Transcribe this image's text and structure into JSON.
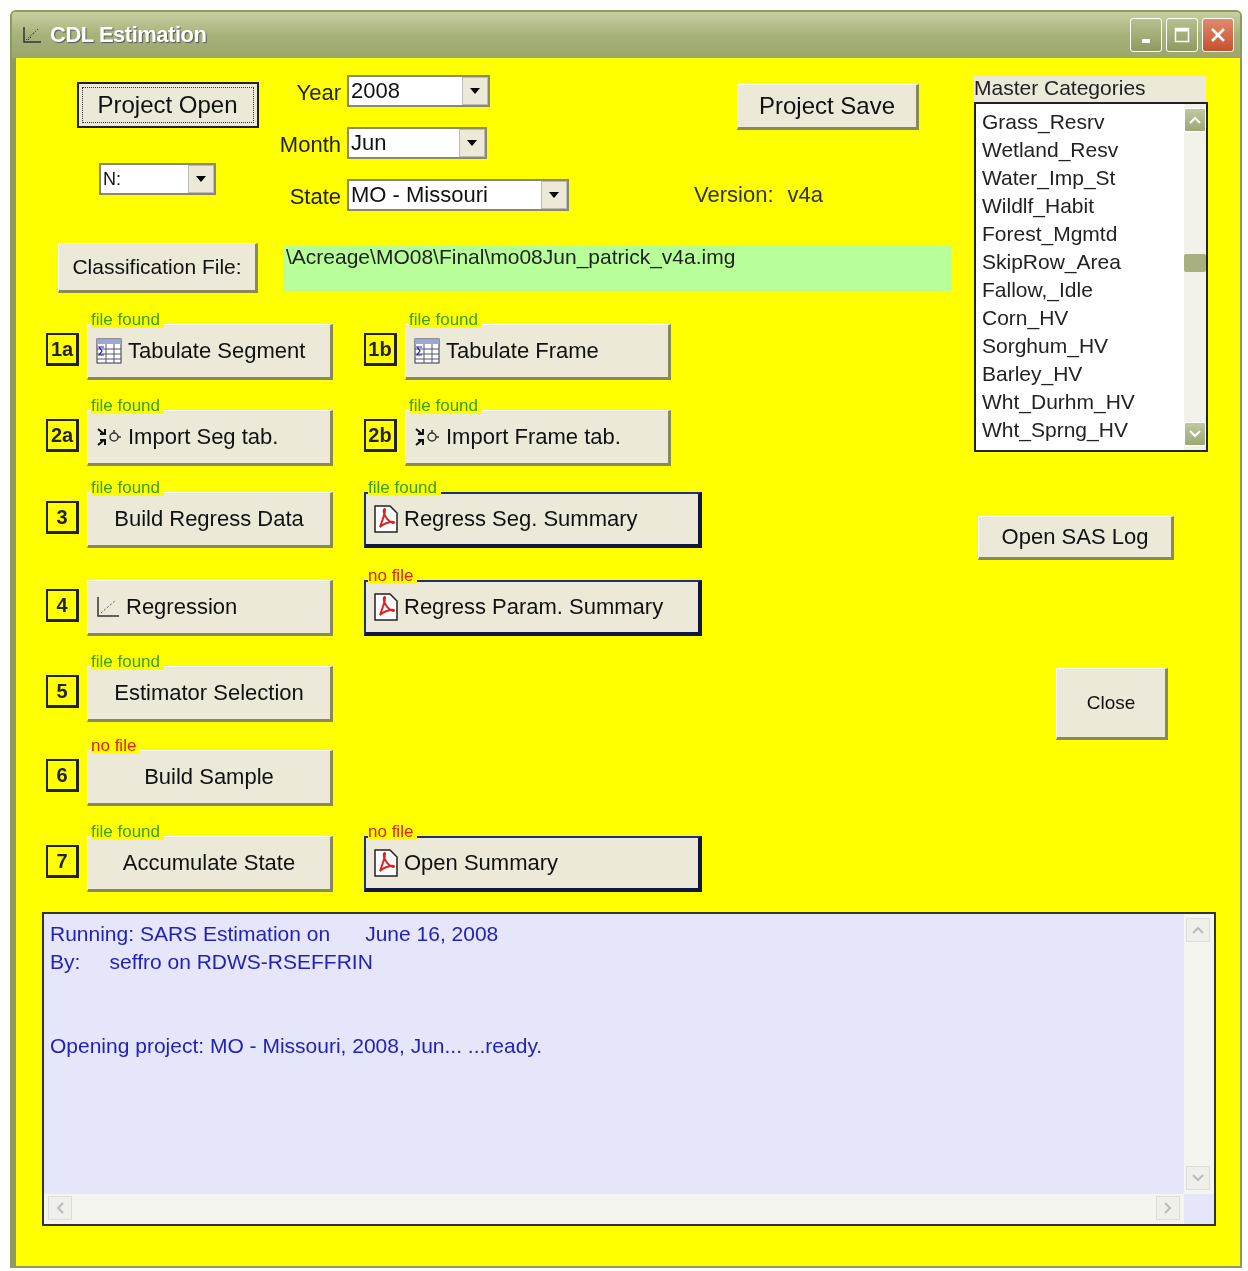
{
  "window": {
    "title": "CDL Estimation"
  },
  "project_open": {
    "label": "Project Open"
  },
  "drive": {
    "value": "N:"
  },
  "selectors": [
    {
      "label": "Year",
      "value": "2008"
    },
    {
      "label": "Month",
      "value": "Jun"
    },
    {
      "label": "State",
      "value": "MO - Missouri"
    }
  ],
  "project_save": {
    "label": "Project Save"
  },
  "version": {
    "label": "Version:",
    "value": "v4a"
  },
  "classification": {
    "button": "Classification File:",
    "path": "\\Acreage\\MO08\\Final\\mo08Jun_patrick_v4a.img"
  },
  "steps": [
    {
      "left": {
        "kind": "tabulate",
        "badge": "1a",
        "label": "Tabulate Segment",
        "status": "file found",
        "file_found": true
      },
      "right": {
        "kind": "tabulate",
        "badge": "1b",
        "label": "Tabulate Frame",
        "status": "file found",
        "file_found": true
      }
    },
    {
      "left": {
        "kind": "import",
        "badge": "2a",
        "label": "Import Seg tab.",
        "status": "file found",
        "file_found": true
      },
      "right": {
        "kind": "import",
        "badge": "2b",
        "label": "Import Frame tab.",
        "status": "file found",
        "file_found": true
      }
    },
    {
      "left": {
        "kind": "plain",
        "badge": "3",
        "label": "Build Regress Data",
        "status": "file found",
        "file_found": true
      },
      "right": {
        "kind": "report",
        "label": "Regress Seg. Summary",
        "status": "file found",
        "file_found": true
      }
    },
    {
      "left": {
        "kind": "regression",
        "badge": "4",
        "label": "Regression"
      },
      "right": {
        "kind": "report",
        "label": "Regress Param. Summary",
        "status": "no file",
        "file_found": false
      }
    },
    {
      "left": {
        "kind": "plain",
        "badge": "5",
        "label": "Estimator Selection",
        "status": "file found",
        "file_found": true
      }
    },
    {
      "left": {
        "kind": "plain",
        "badge": "6",
        "label": "Build Sample",
        "status": "no file",
        "file_found": false
      }
    },
    {
      "left": {
        "kind": "plain",
        "badge": "7",
        "label": "Accumulate State",
        "status": "file found",
        "file_found": true
      },
      "right": {
        "kind": "report",
        "label": "Open Summary",
        "status": "no file",
        "file_found": false
      }
    }
  ],
  "master_categories": {
    "title": "Master Categories",
    "items": [
      "Grass_Resrv",
      "Wetland_Resv",
      "Water_Imp_St",
      "Wildlf_Habit",
      "Forest_Mgmtd",
      "SkipRow_Area",
      "Fallow,_Idle",
      "Corn_HV",
      "Sorghum_HV",
      "Barley_HV",
      "Wht_Durhm_HV",
      "Wht_Sprng_HV"
    ]
  },
  "open_sas_log": {
    "label": "Open SAS Log"
  },
  "close": {
    "label": "Close"
  },
  "log": {
    "blocks": [
      [
        "Running: SARS Estimation on      June 16, 2008",
        "By:     seffro on RDWS-RSEFFRIN"
      ],
      [
        "Opening project: MO - Missouri, 2008, Jun... ...ready."
      ]
    ]
  }
}
